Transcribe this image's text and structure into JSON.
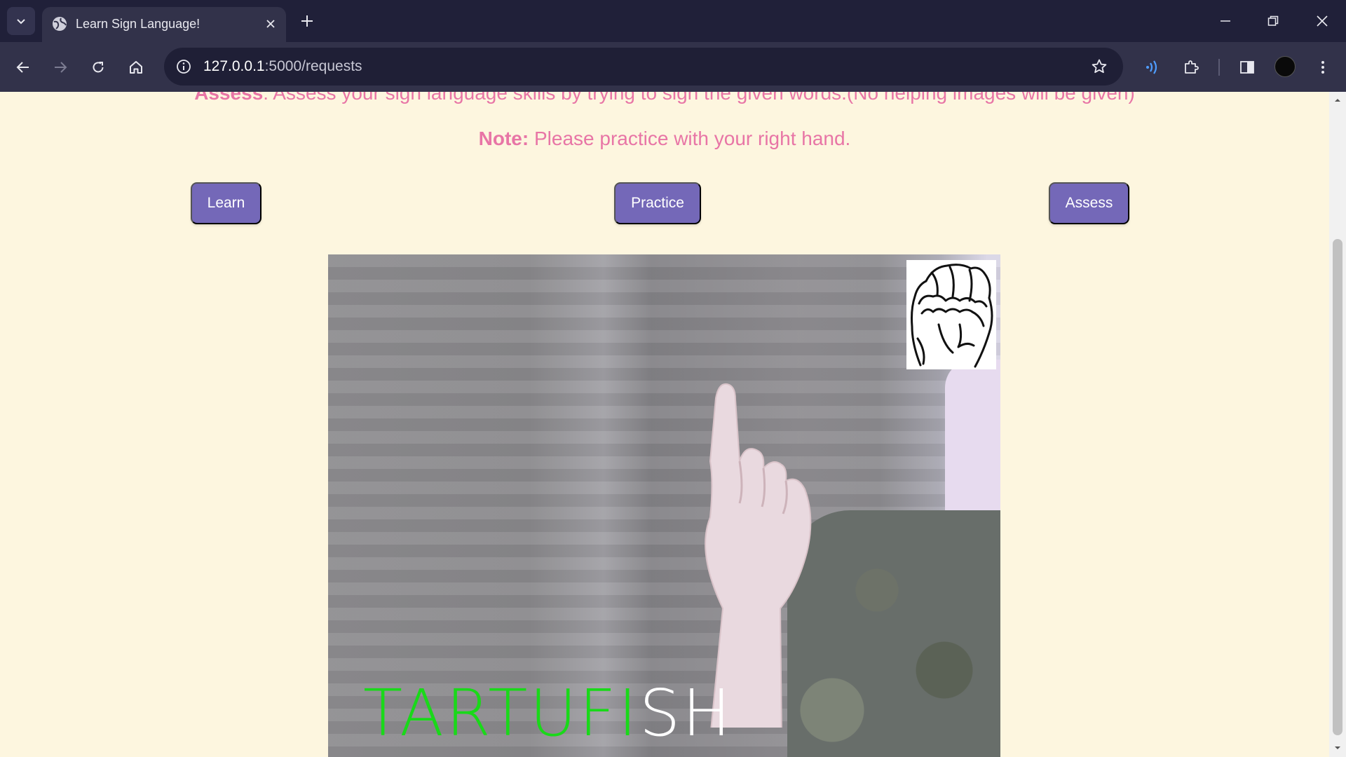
{
  "browser": {
    "tab_title": "Learn Sign Language!",
    "url_host": "127.0.0.1",
    "url_rest": ":5000/requests",
    "icons": {
      "tab_search": "chevron-down-icon",
      "favicon": "globe-icon",
      "tab_close": "close-icon",
      "new_tab": "plus-icon",
      "back": "arrow-left-icon",
      "forward": "arrow-right-icon",
      "reload": "reload-icon",
      "home": "home-icon",
      "site_info": "info-icon",
      "bookmark": "star-icon",
      "extensions": "puzzle-icon",
      "side_panel": "side-panel-icon",
      "menu": "kebab-menu-icon"
    },
    "colors": {
      "tabbar": "#202039",
      "toolbar": "#32324a",
      "omnibox": "#1f1f36"
    }
  },
  "page": {
    "assess_label": "Assess",
    "assess_text": ": Assess your sign language skills by trying to sign the given words.(No helping images will be given)",
    "note_label": "Note:",
    "note_text": " Please practice with your right hand.",
    "buttons": {
      "learn": "Learn",
      "practice": "Practice",
      "assess": "Assess"
    },
    "overlay_word": {
      "done": "TARTUFI",
      "remaining": "SH"
    },
    "colors": {
      "background": "#fdf6df",
      "text": "#e875a6",
      "button": "#7468b8",
      "overlay_done": "#19d919",
      "overlay_remaining": "#ffffff"
    }
  }
}
